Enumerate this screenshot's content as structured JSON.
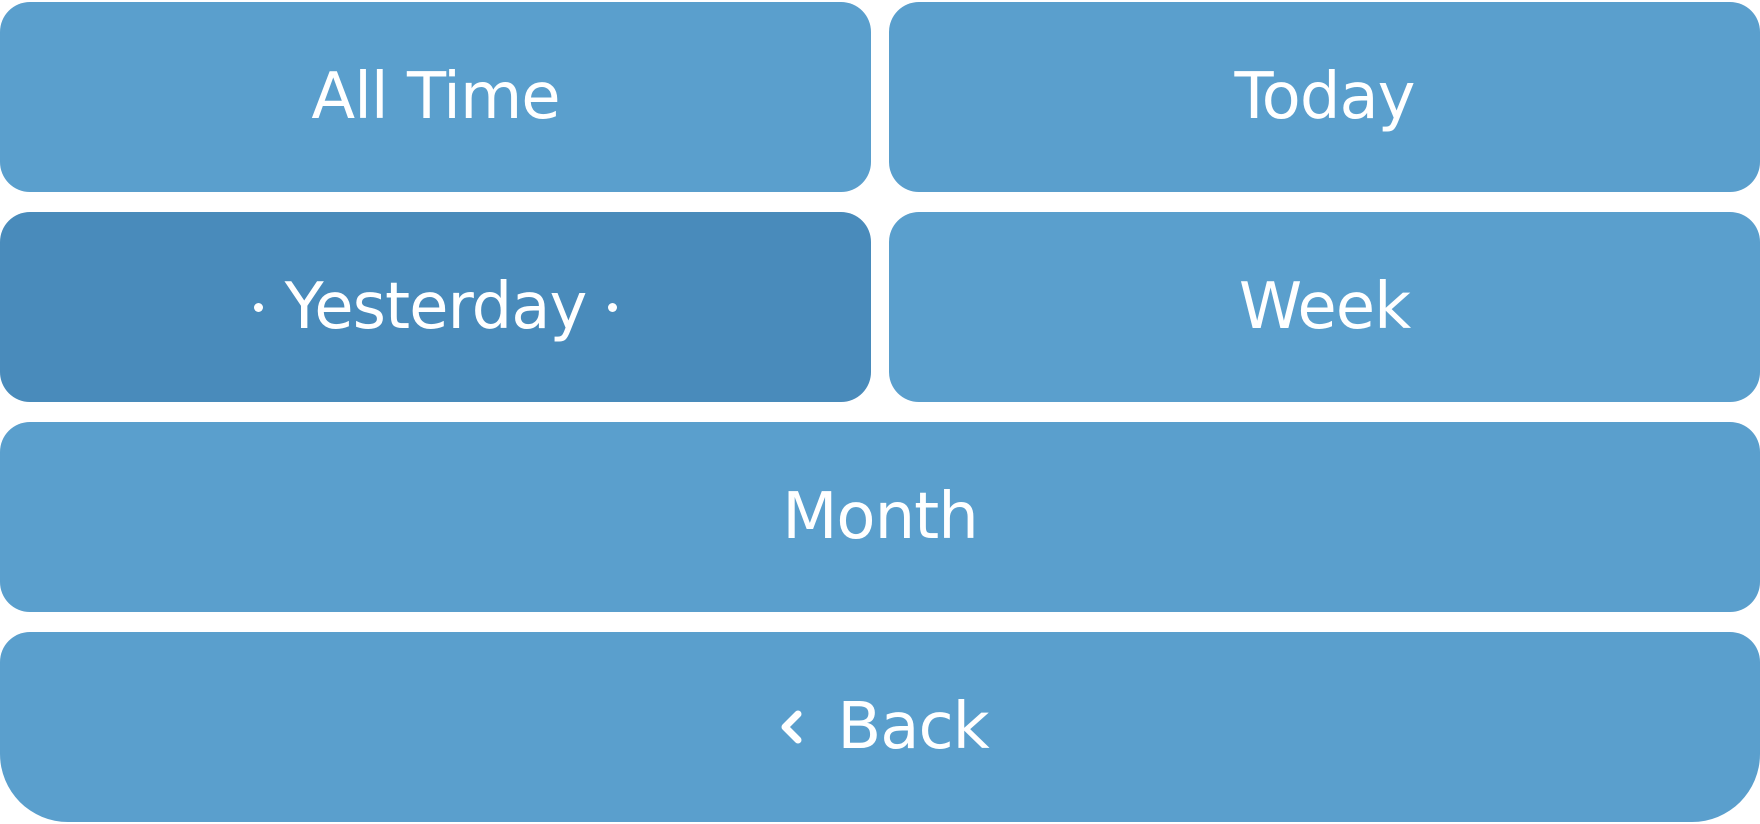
{
  "menu": {
    "all_time": "All Time",
    "today": "Today",
    "yesterday": "Yesterday",
    "week": "Week",
    "month": "Month",
    "back": "Back",
    "selected": "yesterday"
  },
  "icons": {
    "selection_marker": "dot-icon",
    "back": "chevron-left-icon"
  },
  "colors": {
    "button": "#5a9fcd",
    "button_selected": "#498bbb",
    "text": "#ffffff"
  }
}
